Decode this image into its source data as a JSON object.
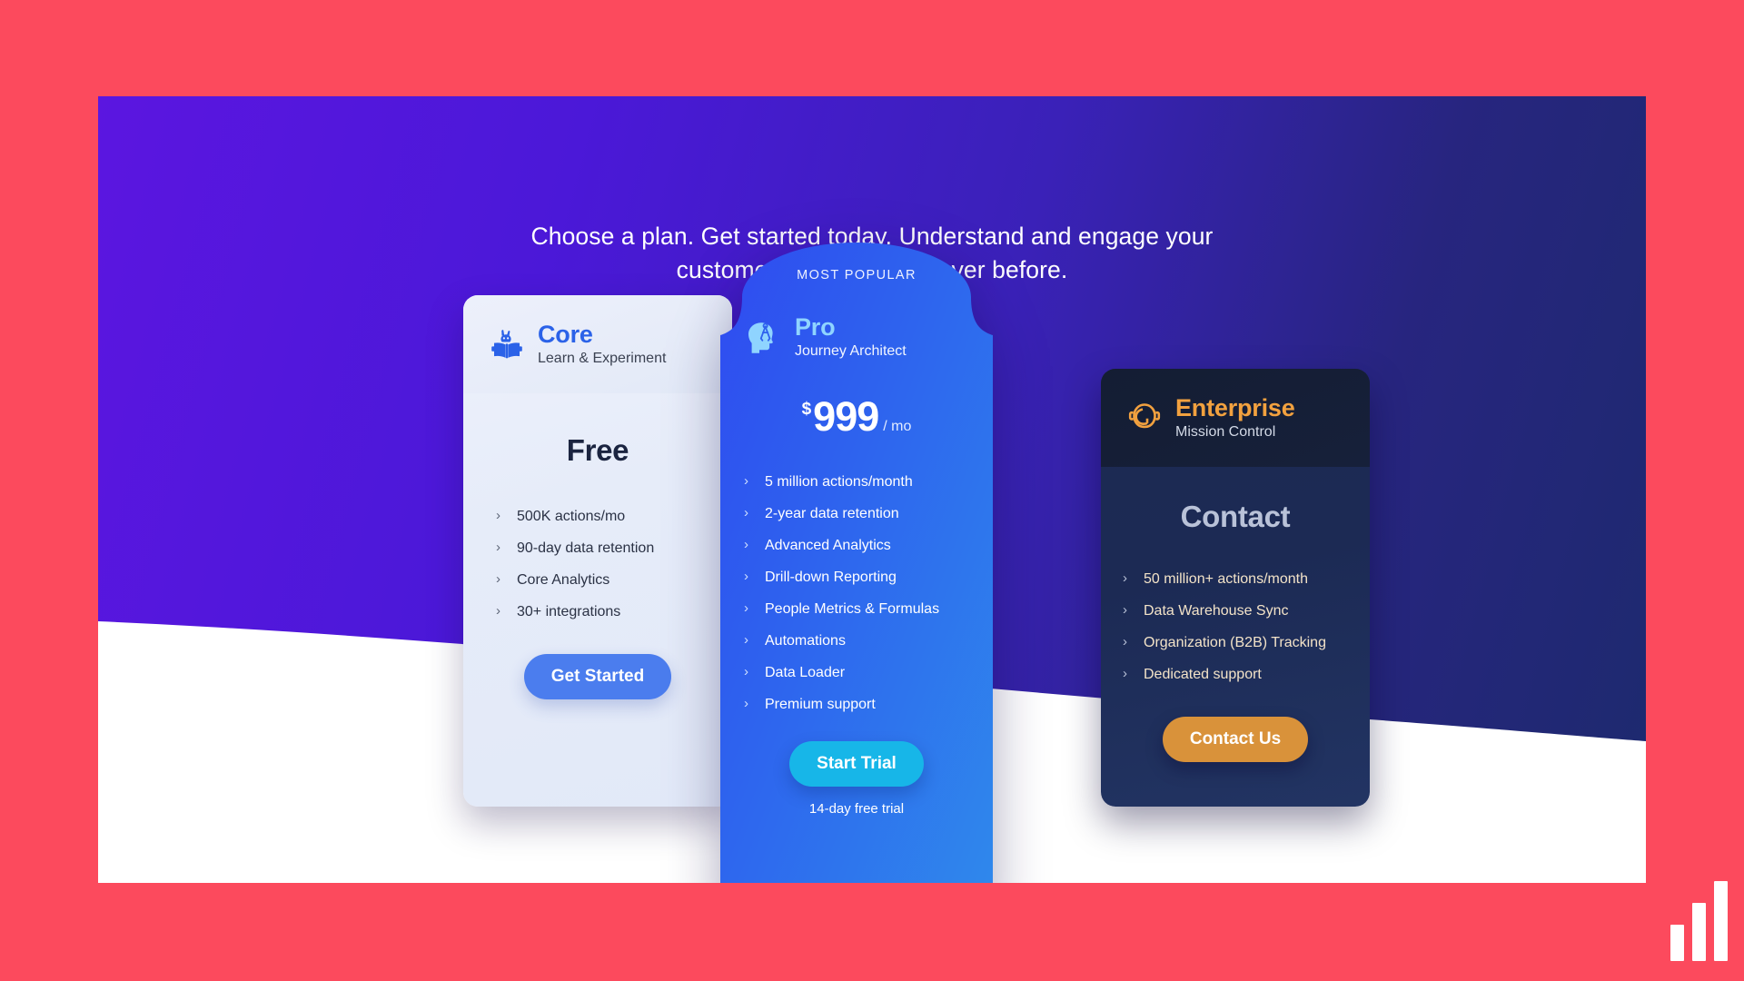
{
  "page": {
    "background_color": "#fc4a5d",
    "hero_gradient_from": "#5b16e0",
    "hero_gradient_to": "#1d2a6e"
  },
  "hero": {
    "headline_line1": "Choose a plan. Get started today. Understand and engage your",
    "headline_line2": "customers to grow like never before."
  },
  "plans": {
    "core": {
      "icon": "rabbit-reading-book-icon",
      "name": "Core",
      "tagline": "Learn & Experiment",
      "price": "Free",
      "accent_color": "#2b62e8",
      "features": [
        "500K actions/mo",
        "90-day data retention",
        "Core Analytics",
        "30+ integrations"
      ],
      "cta_label": "Get Started",
      "cta_color": "#4b7dee"
    },
    "pro": {
      "badge": "MOST POPULAR",
      "icon": "head-with-compass-icon",
      "name": "Pro",
      "tagline": "Journey Architect",
      "price_currency": "$",
      "price_amount": "999",
      "price_period": "/ mo",
      "accent_color": "#8fd4ff",
      "features": [
        "5 million actions/month",
        "2-year data retention",
        "Advanced Analytics",
        "Drill-down Reporting",
        "People Metrics & Formulas",
        "Automations",
        "Data Loader",
        "Premium support"
      ],
      "cta_label": "Start Trial",
      "cta_color": "#17b6e8",
      "trial_note": "14-day free trial"
    },
    "enterprise": {
      "icon": "astronaut-helmet-icon",
      "name": "Enterprise",
      "tagline": "Mission Control",
      "price": "Contact",
      "accent_color": "#f2a13f",
      "features": [
        "50 million+ actions/month",
        "Data Warehouse Sync",
        "Organization (B2B) Tracking",
        "Dedicated support"
      ],
      "cta_label": "Contact Us",
      "cta_color": "#d9923a"
    }
  },
  "widgets": {
    "cookie_icon": "cookie-icon",
    "cookie_color": "#5cb13b",
    "brand_logo_icon": "bar-chart-logo-icon"
  },
  "chevron": "›"
}
